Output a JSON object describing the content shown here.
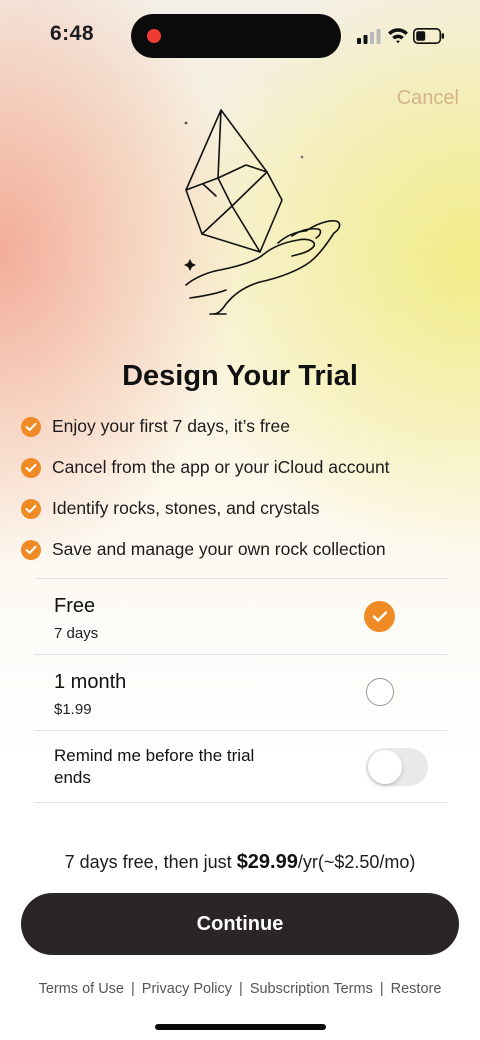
{
  "status_bar": {
    "time": "6:48"
  },
  "header": {
    "cancel_label": "Cancel"
  },
  "hero": {
    "icon": "crystal-in-hand-illustration"
  },
  "title": "Design Your Trial",
  "features": [
    {
      "text": "Enjoy your first 7 days, it’s free"
    },
    {
      "text": "Cancel from the app or your iCloud account"
    },
    {
      "text": "Identify rocks, stones, and crystals"
    },
    {
      "text": "Save and manage your own rock collection"
    }
  ],
  "plans": [
    {
      "title": "Free",
      "subtitle": "7 days",
      "selected": true
    },
    {
      "title": "1 month",
      "subtitle": "$1.99",
      "selected": false
    }
  ],
  "reminder": {
    "label": "Remind me before the trial ends",
    "enabled": false
  },
  "pricing": {
    "prefix": "7 days free, then just ",
    "price": "$29.99",
    "suffix": "/yr(~$2.50/mo)"
  },
  "cta": {
    "label": "Continue"
  },
  "footer": {
    "links": [
      "Terms of Use",
      "Privacy Policy",
      "Subscription Terms",
      "Restore"
    ],
    "separator": "|"
  },
  "colors": {
    "accent": "#f08a24",
    "button": "#2a2628",
    "cancel": "#d4b48a"
  }
}
